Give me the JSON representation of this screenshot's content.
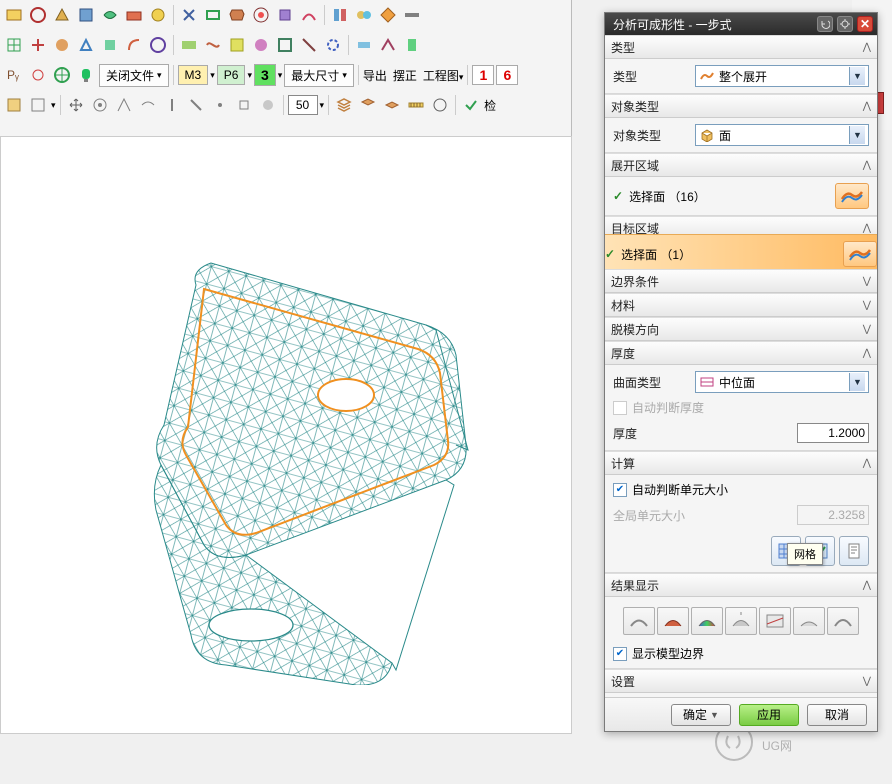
{
  "toolbar": {
    "close_file": "关闭文件",
    "m3": "M3",
    "p6": "P6",
    "three": "3",
    "max_size": "最大尺寸",
    "export": "导出",
    "place": "摆正",
    "drawing": "工程图",
    "ind1": "1",
    "ind6": "6",
    "num50": "50",
    "check": "检",
    "right_label": "导"
  },
  "dialog": {
    "title": "分析可成形性 - 一步式",
    "type_section": "类型",
    "type_label": "类型",
    "type_value": "整个展开",
    "object_type_section": "对象类型",
    "object_type_label": "对象类型",
    "object_type_value": "面",
    "unfold_section": "展开区域",
    "select_face_16": "选择面 （16）",
    "target_section": "目标区域",
    "select_face_1": "选择面 （1）",
    "boundary_section": "边界条件",
    "material_section": "材料",
    "draft_section": "脱模方向",
    "thickness_section": "厚度",
    "surface_type_label": "曲面类型",
    "surface_type_value": "中位面",
    "auto_judge_thickness": "自动判断厚度",
    "thickness_label": "厚度",
    "thickness_value": "1.2000",
    "calc_section": "计算",
    "auto_judge_element": "自动判断单元大小",
    "global_element_label": "全局单元大小",
    "global_element_value": "2.3258",
    "mesh_tooltip": "网格",
    "result_section": "结果显示",
    "show_boundary": "显示模型边界",
    "settings_section": "设置",
    "ok": "确定",
    "apply": "应用",
    "cancel": "取消"
  },
  "watermark": "UG网"
}
